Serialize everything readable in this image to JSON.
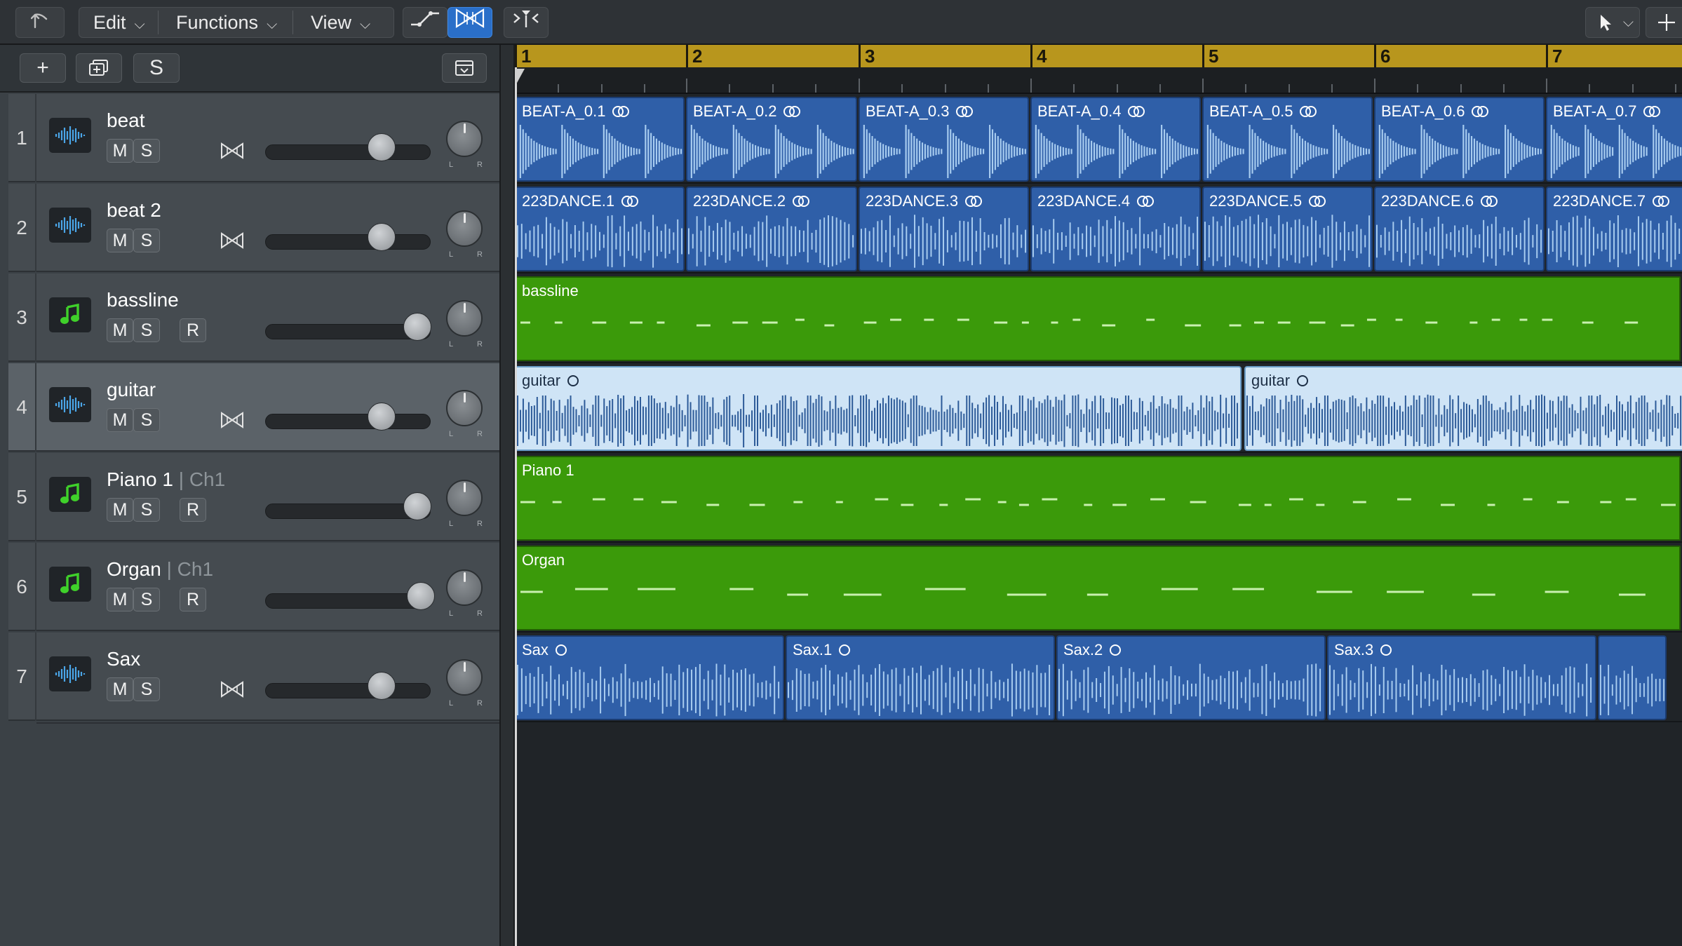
{
  "menubar": {
    "menus": [
      {
        "label": "Edit"
      },
      {
        "label": "Functions"
      },
      {
        "label": "View"
      }
    ]
  },
  "left_toolbar": {
    "solo_label": "S"
  },
  "tracks": [
    {
      "num": "1",
      "name": "beat",
      "channel": "",
      "type": "audio",
      "buttons": [
        "M",
        "S"
      ],
      "fader_level": 0.71
    },
    {
      "num": "2",
      "name": "beat 2",
      "channel": "",
      "type": "audio",
      "buttons": [
        "M",
        "S"
      ],
      "fader_level": 0.71
    },
    {
      "num": "3",
      "name": "bassline",
      "channel": "",
      "type": "midi",
      "buttons": [
        "M",
        "S",
        "R"
      ],
      "fader_level": 0.93
    },
    {
      "num": "4",
      "name": "guitar",
      "channel": "",
      "type": "audio",
      "buttons": [
        "M",
        "S"
      ],
      "fader_level": 0.71,
      "selected": true
    },
    {
      "num": "5",
      "name": "Piano 1",
      "channel": "Ch1",
      "type": "midi",
      "buttons": [
        "M",
        "S",
        "R"
      ],
      "fader_level": 0.93
    },
    {
      "num": "6",
      "name": "Organ",
      "channel": "Ch1",
      "type": "midi",
      "buttons": [
        "M",
        "S",
        "R"
      ],
      "fader_level": 0.95
    },
    {
      "num": "7",
      "name": "Sax",
      "channel": "",
      "type": "audio",
      "buttons": [
        "M",
        "S"
      ],
      "fader_level": 0.71
    }
  ],
  "pan_labels": {
    "left": "L",
    "right": "R"
  },
  "ruler": {
    "bars": [
      "1",
      "2",
      "3",
      "4",
      "5",
      "6",
      "7"
    ]
  },
  "lanes": [
    {
      "track": "beat",
      "regions": [
        {
          "label": "BEAT-A_0.1",
          "loop": "double"
        },
        {
          "label": "BEAT-A_0.2",
          "loop": "double"
        },
        {
          "label": "BEAT-A_0.3",
          "loop": "double"
        },
        {
          "label": "BEAT-A_0.4",
          "loop": "double"
        },
        {
          "label": "BEAT-A_0.5",
          "loop": "double"
        },
        {
          "label": "BEAT-A_0.6",
          "loop": "double"
        },
        {
          "label": "BEAT-A_0.7",
          "loop": "double"
        }
      ]
    },
    {
      "track": "beat 2",
      "regions": [
        {
          "label": "223DANCE.1",
          "loop": "double"
        },
        {
          "label": "223DANCE.2",
          "loop": "double"
        },
        {
          "label": "223DANCE.3",
          "loop": "double"
        },
        {
          "label": "223DANCE.4",
          "loop": "double"
        },
        {
          "label": "223DANCE.5",
          "loop": "double"
        },
        {
          "label": "223DANCE.6",
          "loop": "double"
        },
        {
          "label": "223DANCE.7",
          "loop": "double"
        }
      ]
    },
    {
      "track": "bassline",
      "regions": [
        {
          "label": "bassline",
          "loop": "none"
        }
      ]
    },
    {
      "track": "guitar",
      "regions": [
        {
          "label": "guitar",
          "loop": "single"
        },
        {
          "label": "guitar",
          "loop": "single"
        }
      ]
    },
    {
      "track": "Piano 1",
      "regions": [
        {
          "label": "Piano 1",
          "loop": "none"
        }
      ]
    },
    {
      "track": "Organ",
      "regions": [
        {
          "label": "Organ",
          "loop": "none"
        }
      ]
    },
    {
      "track": "Sax",
      "regions": [
        {
          "label": "Sax",
          "loop": "single"
        },
        {
          "label": "Sax.1",
          "loop": "single"
        },
        {
          "label": "Sax.2",
          "loop": "single"
        },
        {
          "label": "Sax.3",
          "loop": "single"
        },
        {
          "label": "",
          "loop": "none"
        }
      ]
    }
  ],
  "colors": {
    "audio_region": "#2f5fa8",
    "audio_region_selected": "#cfe4f6",
    "midi_region": "#3b9a0a",
    "ruler": "#b8961d",
    "midi_icon": "#3fd12a",
    "audio_icon": "#4aa6e8"
  },
  "icons": {
    "back": "back-arrow-icon",
    "automation": "automation-curve-icon",
    "flex": "flex-bowtie-icon",
    "catch": "catch-playhead-icon",
    "pointer_tool": "pointer-icon",
    "secondary_tool": "marquee-crosshair-icon",
    "add_track": "plus-icon",
    "duplicate_track": "duplicate-track-icon",
    "global_tracks": "global-tracks-icon"
  }
}
